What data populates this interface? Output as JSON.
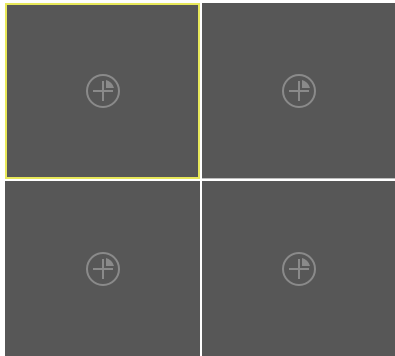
{
  "grid": {
    "layout": "2x2",
    "selected_index": 0,
    "panes": [
      {
        "icon": "add-camera-icon",
        "selected": true
      },
      {
        "icon": "add-camera-icon",
        "selected": false
      },
      {
        "icon": "add-camera-icon",
        "selected": false
      },
      {
        "icon": "add-camera-icon",
        "selected": false
      }
    ]
  },
  "colors": {
    "pane_bg": "#575757",
    "selected_border": "#e8e85a",
    "icon": "#8a8a8a"
  }
}
